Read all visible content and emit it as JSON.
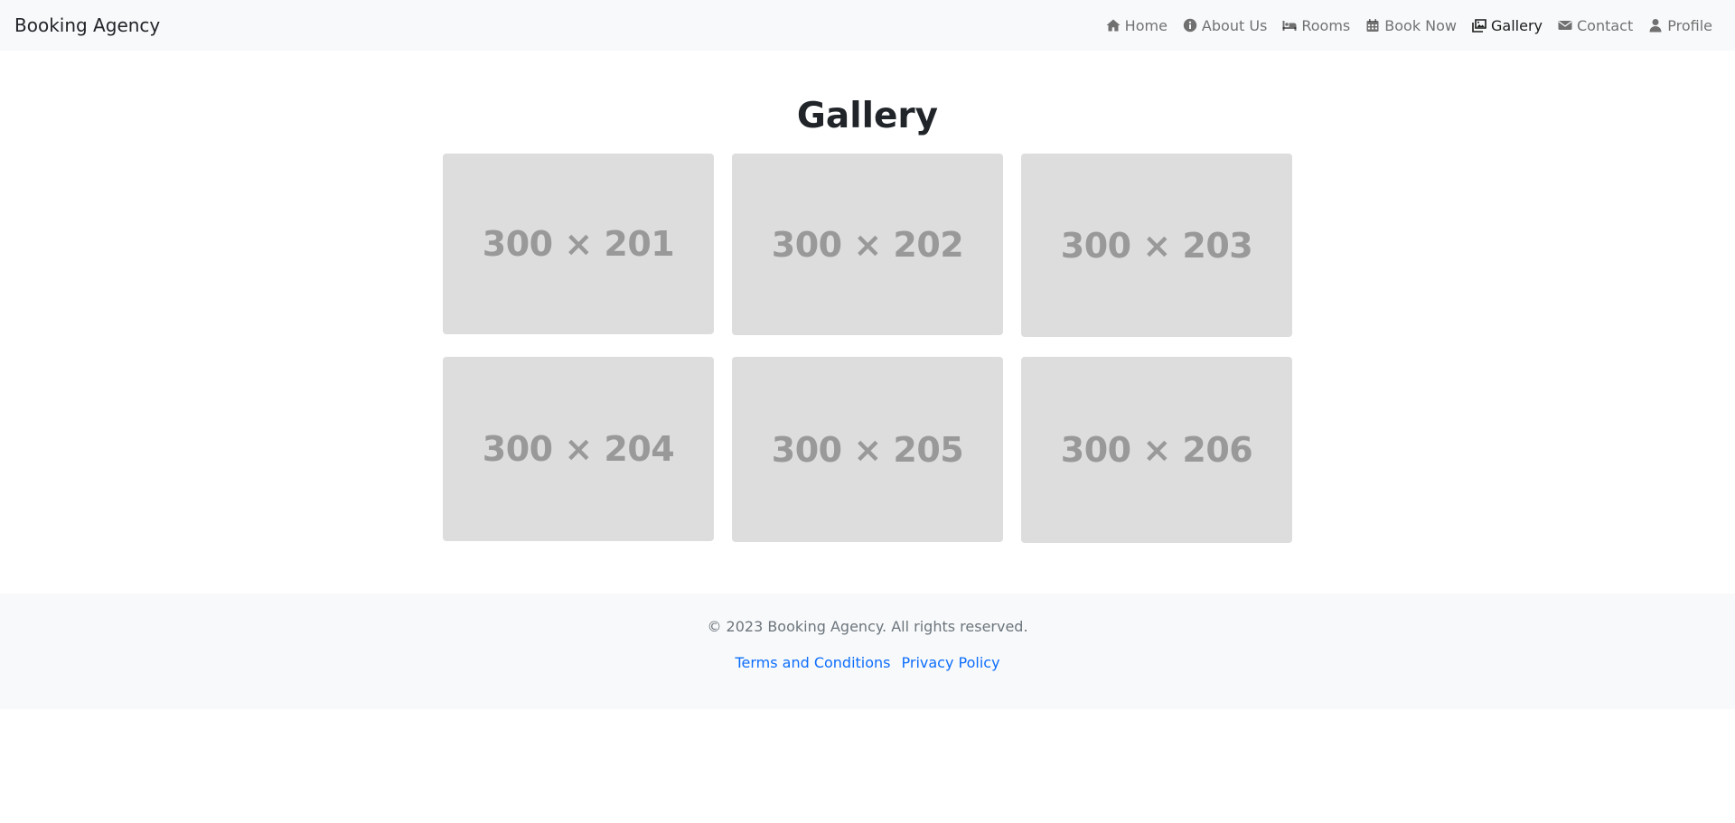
{
  "header": {
    "brand": "Booking Agency",
    "nav": [
      {
        "label": "Home",
        "icon": "home-icon"
      },
      {
        "label": "About Us",
        "icon": "info-icon"
      },
      {
        "label": "Rooms",
        "icon": "bed-icon"
      },
      {
        "label": "Book Now",
        "icon": "calendar-icon"
      },
      {
        "label": "Gallery",
        "icon": "images-icon",
        "active": true
      },
      {
        "label": "Contact",
        "icon": "envelope-icon"
      },
      {
        "label": "Profile",
        "icon": "user-icon"
      }
    ]
  },
  "main": {
    "title": "Gallery",
    "images": [
      {
        "label": "300 × 201"
      },
      {
        "label": "300 × 202"
      },
      {
        "label": "300 × 203"
      },
      {
        "label": "300 × 204"
      },
      {
        "label": "300 × 205"
      },
      {
        "label": "300 × 206"
      }
    ]
  },
  "footer": {
    "copyright": "© 2023 Booking Agency. All rights reserved.",
    "links": [
      {
        "label": "Terms and Conditions"
      },
      {
        "label": "Privacy Policy"
      }
    ]
  },
  "colors": {
    "navbar_bg": "#f8f9fa",
    "placeholder_bg": "#dddddd",
    "placeholder_text": "#999999",
    "link": "#0d6efd"
  }
}
